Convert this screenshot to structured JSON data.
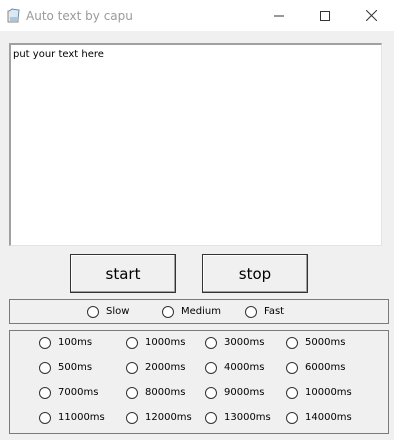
{
  "window": {
    "title": "Auto text by capu"
  },
  "editor": {
    "text": "put your text here"
  },
  "buttons": {
    "start": "start",
    "stop": "stop"
  },
  "speed_options": [
    "Slow",
    "Medium",
    "Fast"
  ],
  "delay_options": [
    [
      "100ms",
      "1000ms",
      "3000ms",
      "5000ms"
    ],
    [
      "500ms",
      "2000ms",
      "4000ms",
      "6000ms"
    ],
    [
      "7000ms",
      "8000ms",
      "9000ms",
      "10000ms"
    ],
    [
      "11000ms",
      "12000ms",
      "13000ms",
      "14000ms"
    ]
  ]
}
